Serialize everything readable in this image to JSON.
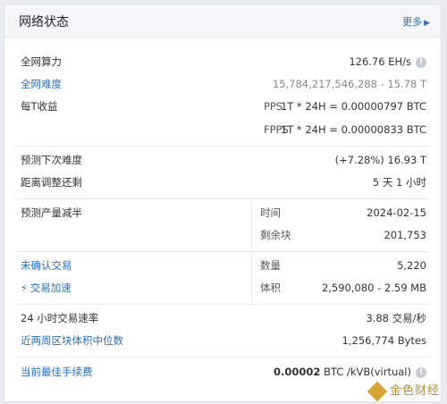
{
  "header": {
    "title": "网络状态",
    "more_label": "更多"
  },
  "hashrate": {
    "label": "全网算力",
    "value": "126.76 EH/s"
  },
  "difficulty": {
    "label": "全网难度",
    "value": "15,784,217,546,288 - 15.78 T"
  },
  "earnings": {
    "label": "每T收益",
    "pps_label": "PPS",
    "pps_value": "1T * 24H = 0.00000797 BTC",
    "fpps_label": "FPPS",
    "fpps_value": "1T * 24H = 0.00000833 BTC"
  },
  "next_difficulty": {
    "label": "预测下次难度",
    "value": "(+7.28%) 16.93 T"
  },
  "adjust": {
    "label": "距离调整还剩",
    "value": "5 天 1 小时"
  },
  "halving": {
    "label": "预测产量减半",
    "time_label": "时间",
    "time_value": "2024-02-15",
    "blocks_label": "剩余块",
    "blocks_value": "201,753"
  },
  "unconfirmed": {
    "label": "未确认交易",
    "count_label": "数量",
    "count_value": "5,220",
    "accel_label": "交易加速",
    "size_label": "体积",
    "size_value": "2,590,080 - 2.59 MB"
  },
  "tx_rate": {
    "label": "24 小时交易速率",
    "value": "3.88 交易/秒"
  },
  "median_size": {
    "label": "近两周区块体积中位数",
    "value": "1,256,774 Bytes"
  },
  "fee": {
    "label": "当前最佳手续费",
    "value_bold": "0.00002",
    "value_rest": "BTC /kVB(virtual)"
  },
  "watermark": {
    "text": "金色财经"
  },
  "colors": {
    "link": "#2a6ebb",
    "header_bg": "#f4f6f8",
    "brand": "#d4a437"
  }
}
